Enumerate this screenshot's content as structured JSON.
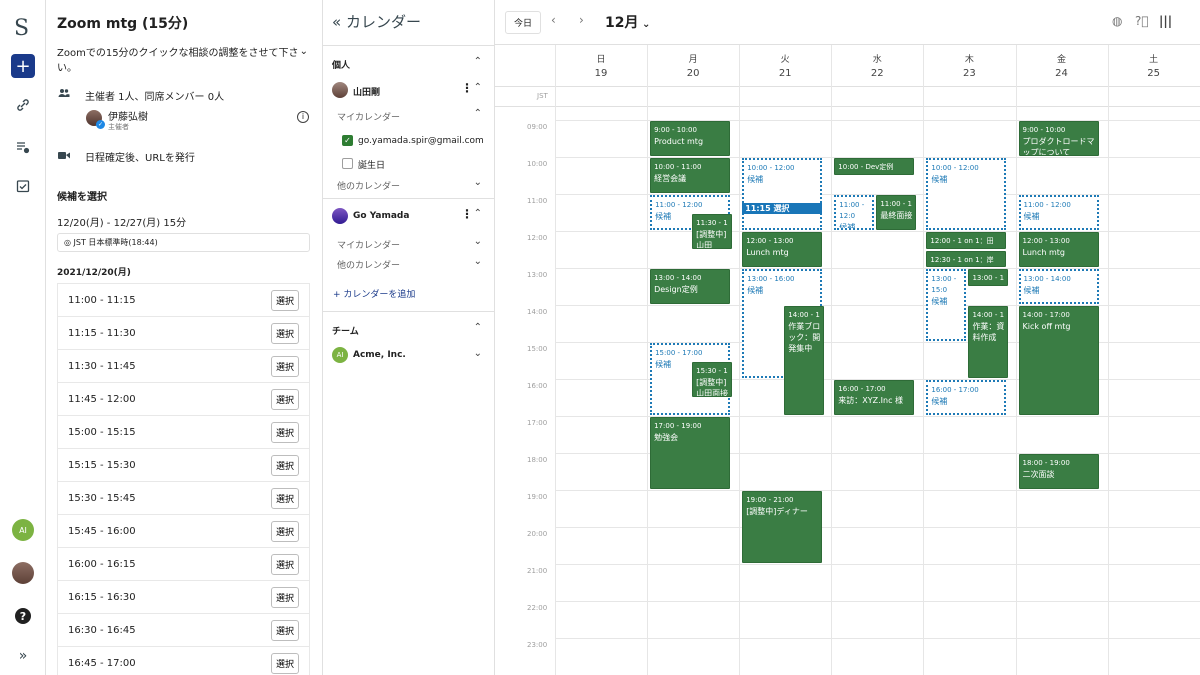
{
  "rail": {
    "logo": "S",
    "plus": "+",
    "ai_badge": "AI"
  },
  "event": {
    "title": "Zoom mtg (15分)",
    "description": "Zoomでの15分のクイックな相談の調整をさせて下さい。",
    "attendees": "主催者 1人、同席メンバー 0人",
    "host_name": "伊藤弘樹",
    "host_role": "主催者",
    "url_note": "日程確定後、URLを発行",
    "candidates_title": "候補を選択",
    "range": "12/20(月) - 12/27(月) 15分",
    "timezone": "JST 日本標準時(18:44)",
    "date_heading": "2021/12/20(月)",
    "select_label": "選択",
    "slots": [
      "11:00 - 11:15",
      "11:15 - 11:30",
      "11:30 - 11:45",
      "11:45 - 12:00",
      "15:00 - 15:15",
      "15:15 - 15:30",
      "15:30 - 15:45",
      "15:45 - 16:00",
      "16:00 - 16:15",
      "16:15 - 16:30",
      "16:30 - 16:45",
      "16:45 - 17:00"
    ]
  },
  "calendars": {
    "header": "カレンダー",
    "personal_label": "個人",
    "user1": "山田剛",
    "my_calendars": "マイカレンダー",
    "email": "go.yamada.spir@gmail.com",
    "birthdays": "誕生日",
    "other_calendars": "他のカレンダー",
    "user2": "Go Yamada",
    "my_calendars_2": "マイカレンダー",
    "other_calendars_2": "他のカレンダー",
    "add_calendar": "+ カレンダーを追加",
    "team_label": "チーム",
    "team_name": "Acme, Inc.",
    "team_badge": "AI"
  },
  "grid": {
    "today": "今日",
    "month": "12月",
    "tz_label": "JST",
    "days": [
      {
        "dow": "日",
        "date": "19"
      },
      {
        "dow": "月",
        "date": "20"
      },
      {
        "dow": "火",
        "date": "21"
      },
      {
        "dow": "水",
        "date": "22"
      },
      {
        "dow": "木",
        "date": "23"
      },
      {
        "dow": "金",
        "date": "24"
      },
      {
        "dow": "土",
        "date": "25"
      }
    ],
    "hours": [
      "09:00",
      "10:00",
      "11:00",
      "12:00",
      "13:00",
      "14:00",
      "15:00",
      "16:00",
      "17:00",
      "18:00",
      "19:00",
      "20:00",
      "21:00",
      "22:00",
      "23:00"
    ],
    "events": [
      {
        "day": 1,
        "start": 9,
        "end": 10,
        "time": "9:00 - 10:00",
        "name": "Product mtg",
        "col": 0,
        "cols": 1
      },
      {
        "day": 1,
        "start": 10,
        "end": 11,
        "time": "10:00 - 11:00",
        "name": "経営会議",
        "col": 0,
        "cols": 1
      },
      {
        "day": 1,
        "start": 11.5,
        "end": 12.5,
        "time": "11:30 - 1",
        "name": "[調整中]山田",
        "col": 1,
        "cols": 2
      },
      {
        "day": 1,
        "start": 13,
        "end": 14,
        "time": "13:00 - 14:00",
        "name": "Design定例",
        "col": 0,
        "cols": 1
      },
      {
        "day": 1,
        "start": 15.5,
        "end": 16.5,
        "time": "15:30 - 1",
        "name": "[調整中]山田面接",
        "col": 1,
        "cols": 2
      },
      {
        "day": 1,
        "start": 17,
        "end": 19,
        "time": "17:00 - 19:00",
        "name": "勉強会",
        "col": 0,
        "cols": 1
      },
      {
        "day": 2,
        "start": 12,
        "end": 13,
        "time": "12:00 - 13:00",
        "name": "Lunch mtg",
        "col": 0,
        "cols": 1
      },
      {
        "day": 2,
        "start": 14,
        "end": 17,
        "time": "14:00 - 1",
        "name": "作業ブロック：開発集中",
        "col": 1,
        "cols": 2
      },
      {
        "day": 2,
        "start": 19,
        "end": 21,
        "time": "19:00 - 21:00",
        "name": "[調整中]ディナー",
        "col": 0,
        "cols": 1
      },
      {
        "day": 3,
        "start": 10,
        "end": 10.5,
        "time": "10:00 - Dev定例",
        "name": "",
        "col": 0,
        "cols": 1
      },
      {
        "day": 3,
        "start": 11,
        "end": 12,
        "time": "11:00 - 1",
        "name": "最終面接",
        "col": 1,
        "cols": 2
      },
      {
        "day": 3,
        "start": 16,
        "end": 17,
        "time": "16:00 - 17:00",
        "name": "来訪：XYZ.Inc 様",
        "col": 0,
        "cols": 1
      },
      {
        "day": 4,
        "start": 12,
        "end": 12.5,
        "time": "12:00 - 1 on 1：田",
        "name": "",
        "col": 0,
        "cols": 1
      },
      {
        "day": 4,
        "start": 12.5,
        "end": 13,
        "time": "12:30 - 1 on 1：岸",
        "name": "",
        "col": 0,
        "cols": 1
      },
      {
        "day": 4,
        "start": 13,
        "end": 13.5,
        "time": "13:00 - 1",
        "name": "",
        "col": 1,
        "cols": 2
      },
      {
        "day": 4,
        "start": 14,
        "end": 16,
        "time": "14:00 - 1",
        "name": "作業：資料作成",
        "col": 1,
        "cols": 2
      },
      {
        "day": 5,
        "start": 9,
        "end": 10,
        "time": "9:00 - 10:00",
        "name": "プロダクトロードマップについて",
        "col": 0,
        "cols": 1
      },
      {
        "day": 5,
        "start": 12,
        "end": 13,
        "time": "12:00 - 13:00",
        "name": "Lunch mtg",
        "col": 0,
        "cols": 1
      },
      {
        "day": 5,
        "start": 14,
        "end": 17,
        "time": "14:00 - 17:00",
        "name": "Kick off mtg",
        "col": 0,
        "cols": 1
      },
      {
        "day": 5,
        "start": 18,
        "end": 19,
        "time": "18:00 - 19:00",
        "name": "二次面談",
        "col": 0,
        "cols": 1
      }
    ],
    "candidates": [
      {
        "day": 1,
        "start": 11,
        "end": 12,
        "time": "11:00 - 12:00",
        "label": "候補",
        "cols": 1
      },
      {
        "day": 1,
        "start": 15,
        "end": 17,
        "time": "15:00 - 17:00",
        "label": "候補",
        "cols": 1
      },
      {
        "day": 2,
        "start": 10,
        "end": 12,
        "time": "10:00 - 12:00",
        "label": "候補",
        "cols": 1
      },
      {
        "day": 2,
        "start": 13,
        "end": 16,
        "time": "13:00 - 16:00",
        "label": "候補",
        "cols": 1
      },
      {
        "day": 3,
        "start": 11,
        "end": 12,
        "time": "11:00 - 12:0",
        "label": "候補",
        "cols": 2
      },
      {
        "day": 4,
        "start": 10,
        "end": 12,
        "time": "10:00 - 12:00",
        "label": "候補",
        "cols": 1
      },
      {
        "day": 4,
        "start": 13,
        "end": 15,
        "time": "13:00 - 15:0",
        "label": "候補",
        "cols": 2
      },
      {
        "day": 4,
        "start": 16,
        "end": 17,
        "time": "16:00 - 17:00",
        "label": "候補",
        "cols": 1
      },
      {
        "day": 5,
        "start": 11,
        "end": 12,
        "time": "11:00 - 12:00",
        "label": "候補",
        "cols": 1
      },
      {
        "day": 5,
        "start": 13,
        "end": 14,
        "time": "13:00 - 14:00",
        "label": "候補",
        "cols": 1
      }
    ],
    "selection": {
      "day": 2,
      "start": 11.25,
      "label": "11:15 選択"
    }
  },
  "colors": {
    "event_green": "#3a7d44",
    "candidate_blue": "#1e7ab6",
    "selection_blue": "#1976b8",
    "rail_plus": "#1a3a8a"
  }
}
